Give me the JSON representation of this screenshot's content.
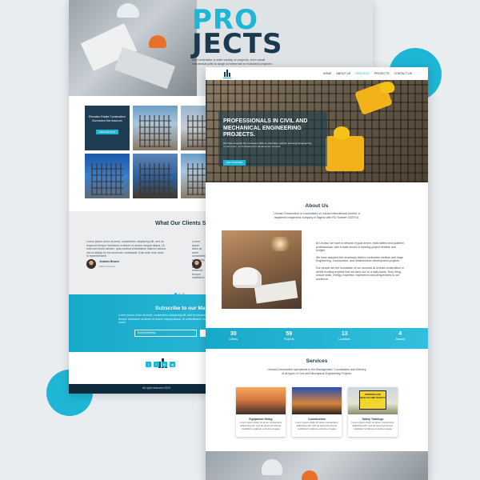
{
  "back_page": {
    "hero": {
      "title_line1": "PRO",
      "title_line2": "JECTS",
      "subtitle": "We Undertake a wide variety of projects, from small residential jobs to large commercial or industrial projects."
    },
    "grid_tile": {
      "text": "Elevation Estate Construction Burundora Ifon Inaccum",
      "button": "VIEW DETAILS"
    },
    "clients": {
      "title": "What Our Clients Say",
      "testimonial_text": "Lorem ipsum dolor sit amet, consectetur adipiscing elit, sed do eiusmod tempor incididunt ut labore et dolore magna aliqua. Ut enim ad minim veniam, quis nostrud exercitation ullamco laboris nisi ut aliquip ex ea commodo consequat. Duis aute irure dolor in reprehenderit.",
      "testimonial_text_2": "Lorem ipsum dolor sit amet, consectetur adipiscing elit, sed do eiusmod tempor incididunt.",
      "name": "Jenkins Brown",
      "company": "ABC Customer"
    },
    "subscribe": {
      "title": "Subscribe to our Mail!",
      "text": "Lorem ipsum dolor sit amet, consectetur adipiscing elit, sed do eiusmod tempor incididunt ut labore et dolore magna aliqua. Ut pellentesque massa lorem.",
      "placeholder": "Email Address"
    },
    "footer": {
      "copyright": "All right reserved 2020",
      "social": [
        "t",
        "f",
        "in",
        "ig"
      ]
    }
  },
  "front_page": {
    "nav": [
      "HOME",
      "ABOUT US",
      "SERVICES",
      "PROJECTS",
      "CONTACT US"
    ],
    "nav_active": "SERVICES",
    "hero": {
      "title": "PROFESSIONALS IN CIVIL AND MECHANICAL ENGINEERING PROJECTS.",
      "subtitle": "We have acquired the necessary skills to undertake medium and large Engineering, Construction, and Infrastructure development projects.",
      "button": "GET STARTED"
    },
    "about": {
      "title": "About Us",
      "intro": "Urchad Construction is a subsidiary of Urchad International Limited, a registered indigenous company in Nigeria with RC Number 1623714.",
      "p1": "At Urchad, we have a network of goal driven, multi-skilled and qualified professionals, with a track record of meeting project timeline and budget.",
      "p2": "We have acquired the necessary skills to undertake medium and large Engineering, Construction, and Infrastructure development projects.",
      "p3": "Our people are the foundation of our success at Urchad construction in all the exciting projects that we carry out on a daily basis. They bring unique skills, energy, expertise, experience and perspectives to our workforce."
    },
    "stats": [
      {
        "num": "30",
        "label": "Clients"
      },
      {
        "num": "59",
        "label": "Projects"
      },
      {
        "num": "13",
        "label": "Locations"
      },
      {
        "num": "4",
        "label": "Awards"
      }
    ],
    "services": {
      "title": "Services",
      "intro": "Urchad Construction specializes in the Management, Coordination and Delivery of all types of Civil and Mechanical Engineering Projects.",
      "cards": [
        {
          "title": "Equipment Hiring",
          "text": "Lorem ipsum dolor sit amet, consectetur adipiscing elit, sed do eiusmod tempor incididunt ut labore et dolore magna"
        },
        {
          "title": "Construction",
          "text": "Lorem ipsum dolor sit amet, consectetur adipiscing elit, sed do eiusmod tempor incididunt ut labore et dolore magna"
        },
        {
          "title": "Safety Trainings",
          "text": "Lorem ipsum dolor sit amet, consectetur adipiscing elit, sed do eiusmod tempor incididunt ut labore et dolore magna"
        }
      ],
      "sign_text": "WORKPLACE HEALTH AND SAFETY"
    }
  },
  "colors": {
    "accent": "#1fb6d6",
    "navy": "#1c3a4f"
  }
}
